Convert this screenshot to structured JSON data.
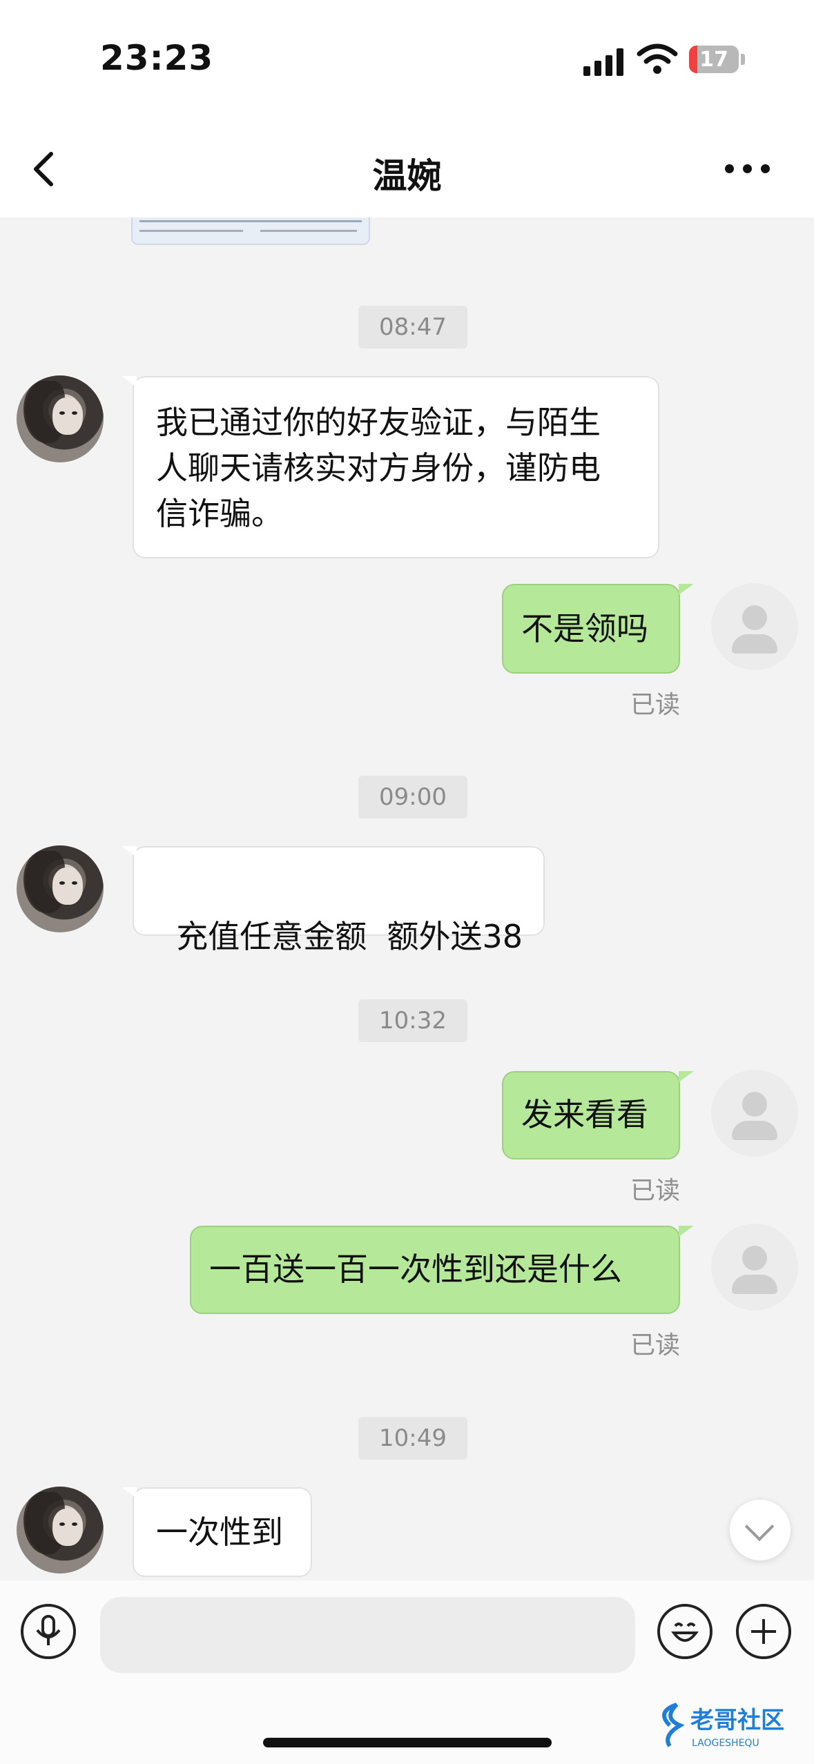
{
  "status_bar": {
    "time": "23:23",
    "battery": "17",
    "battery_level_percent": 17
  },
  "nav": {
    "title": "温婉"
  },
  "messages": [
    {
      "kind": "timestamp",
      "text": "08:47"
    },
    {
      "kind": "incoming",
      "lines": [
        "我已通过你的好友验证，与陌生",
        "人聊天请核实对方身份，谨防电",
        "信诈骗。"
      ]
    },
    {
      "kind": "outgoing",
      "text": "不是领吗",
      "receipt": "已读"
    },
    {
      "kind": "timestamp",
      "text": "09:00"
    },
    {
      "kind": "incoming",
      "text": "充值任意金额  额外送38"
    },
    {
      "kind": "timestamp",
      "text": "10:32"
    },
    {
      "kind": "outgoing",
      "text": "发来看看",
      "receipt": "已读"
    },
    {
      "kind": "outgoing",
      "text": "一百送一百一次性到还是什么",
      "receipt": "已读"
    },
    {
      "kind": "timestamp",
      "text": "10:49"
    },
    {
      "kind": "incoming",
      "text": "一次性到"
    }
  ],
  "icons": {
    "back": "chevron-left-icon",
    "more": "more-horizontal-icon",
    "scroll_down": "chevron-down-icon",
    "voice": "microphone-icon",
    "emoji": "smile-icon",
    "attach": "plus-icon",
    "wifi": "wifi-icon",
    "signal": "signal-icon"
  },
  "watermark": {
    "text": "老哥社区",
    "subtext": "LAOGESHEQU"
  },
  "colors": {
    "outgoing_bubble": "#b6e89a",
    "incoming_bubble": "#ffffff",
    "battery_low": "#f04040"
  }
}
